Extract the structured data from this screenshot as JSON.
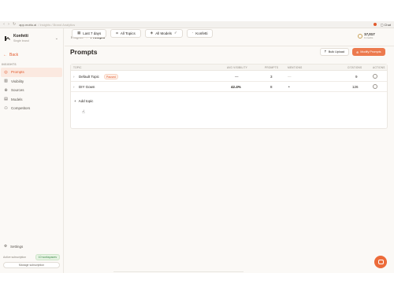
{
  "browser": {
    "back": "‹",
    "forward": "›",
    "reload": "↻",
    "url_host": "app.mottu.ai",
    "url_path": "/ Insights  / Brand Analytics",
    "chat_label": "Chat"
  },
  "sidebar": {
    "brand_name": "Konfetti",
    "brand_sub": "Single brand",
    "back_label": "Back",
    "section_label": "INSIGHTS",
    "items": [
      {
        "label": "Prompts",
        "icon": "◎",
        "active": true
      },
      {
        "label": "Visibility",
        "icon": "▥",
        "active": false
      },
      {
        "label": "Sources",
        "icon": "⊕",
        "active": false
      },
      {
        "label": "Models",
        "icon": "▤",
        "active": false
      },
      {
        "label": "Competitors",
        "icon": "⚇",
        "active": false
      }
    ],
    "settings_label": "Settings",
    "subscription_text": "Active subscription",
    "subscription_badge": "10 workspaces",
    "manage_label": "Manage subscription"
  },
  "topbar": {
    "crumb_parent": "Insights",
    "crumb_sep": "›",
    "crumb_current": "Prompts",
    "credits_value": "17,017",
    "credits_sub": "0 credits"
  },
  "filters": [
    {
      "label": "Last 7 days",
      "icon": "▦"
    },
    {
      "label": "All Topics",
      "icon": "⌗"
    },
    {
      "label": "All Models",
      "icon": "◈",
      "suffix": "✓"
    },
    {
      "label": "Konfetti",
      "icon": "·"
    }
  ],
  "page": {
    "title": "Prompts",
    "bulk_upload": "Bulk Upload",
    "modify_prompts": "Modify Prompts"
  },
  "table": {
    "headers": {
      "topic": "TOPIC",
      "visibility": "AVG VISIBILITY",
      "prompts": "PROMPTS",
      "mentions": "MENTIONS",
      "citations": "CITATIONS",
      "actions": "ACTIONS"
    },
    "rows": [
      {
        "topic": "Default Topic",
        "badge": "Paused",
        "visibility": "—",
        "prompts": "3",
        "mentions": "—",
        "citations": "9"
      },
      {
        "topic": "DIY Gown",
        "badge": "",
        "visibility": "42.4%",
        "prompts": "8",
        "mentions": "•",
        "citations": "126"
      }
    ],
    "add_topic": "Add topic"
  }
}
